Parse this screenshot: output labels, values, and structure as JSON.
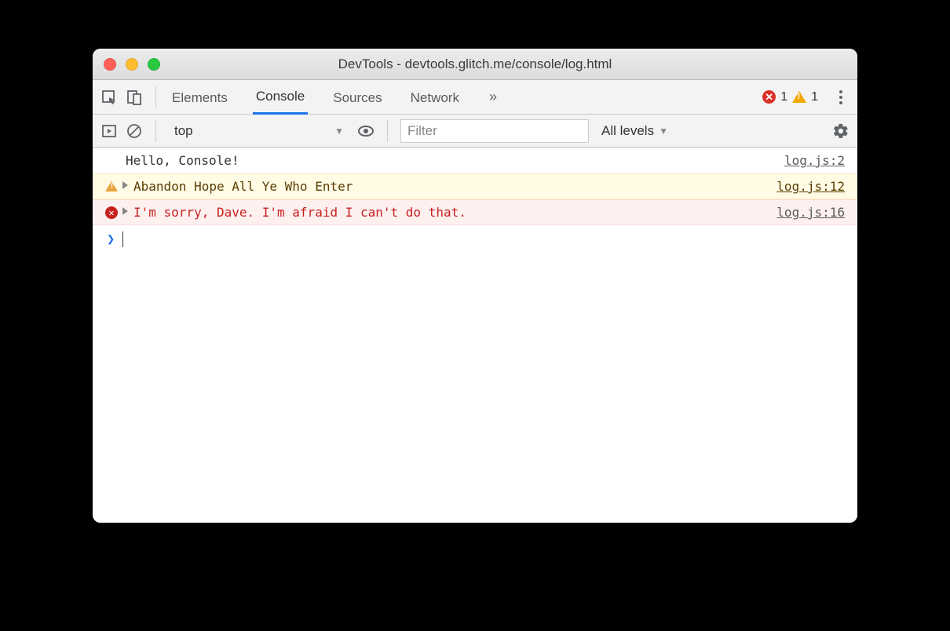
{
  "window": {
    "title": "DevTools - devtools.glitch.me/console/log.html"
  },
  "tabs": {
    "items": [
      "Elements",
      "Console",
      "Sources",
      "Network"
    ],
    "active_index": 1
  },
  "status": {
    "error_count": "1",
    "warning_count": "1"
  },
  "subbar": {
    "context": "top",
    "filter_placeholder": "Filter",
    "levels": "All levels"
  },
  "messages": [
    {
      "type": "log",
      "text": "Hello, Console!",
      "source": "log.js:2",
      "expandable": false
    },
    {
      "type": "warn",
      "text": "Abandon Hope All Ye Who Enter",
      "source": "log.js:12",
      "expandable": true
    },
    {
      "type": "error",
      "text": "I'm sorry, Dave. I'm afraid I can't do that.",
      "source": "log.js:16",
      "expandable": true
    }
  ],
  "prompt": "❯"
}
